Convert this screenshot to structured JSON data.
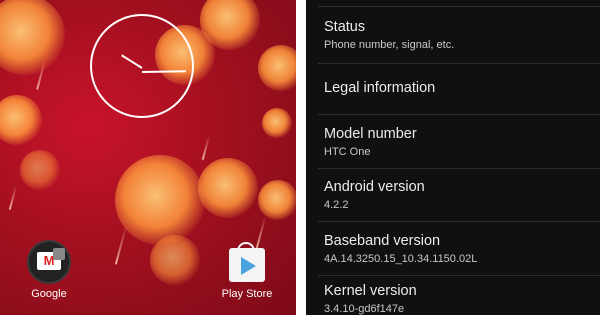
{
  "home": {
    "apps": [
      {
        "label": "Google",
        "icon": "gmail-folder-icon"
      },
      {
        "label": "Play Store",
        "icon": "play-store-icon"
      }
    ]
  },
  "settings": {
    "items": [
      {
        "title": "Status",
        "subtitle": "Phone number, signal, etc."
      },
      {
        "title": "Legal information",
        "subtitle": ""
      },
      {
        "title": "Model number",
        "subtitle": "HTC One"
      },
      {
        "title": "Android version",
        "subtitle": "4.2.2"
      },
      {
        "title": "Baseband version",
        "subtitle": "4A.14.3250.15_10.34.1150.02L"
      },
      {
        "title": "Kernel version",
        "subtitle": "3.4.10-gd6f147e"
      }
    ]
  },
  "colors": {
    "wallpaper": "#a3101f",
    "settings_bg": "#101010"
  }
}
